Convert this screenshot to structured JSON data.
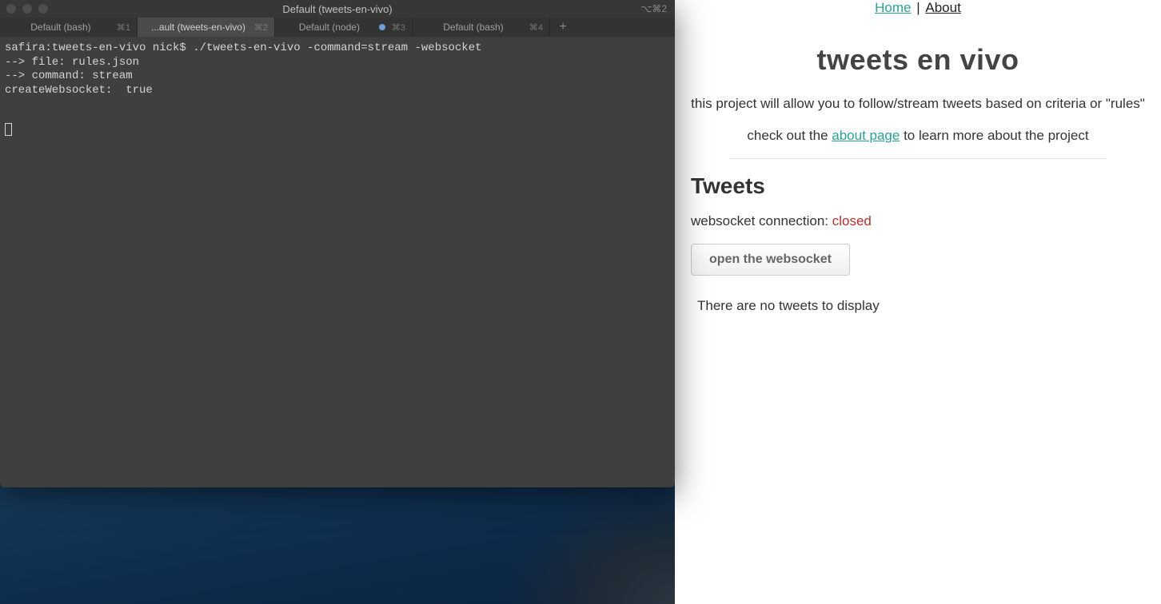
{
  "terminal": {
    "window_title": "Default (tweets-en-vivo)",
    "titlebar_shortcut": "⌥⌘2",
    "tabs": [
      {
        "label": "Default (bash)",
        "shortcut": "⌘1",
        "active": false,
        "indicator": false
      },
      {
        "label": "...ault (tweets-en-vivo)",
        "shortcut": "⌘2",
        "active": true,
        "indicator": false
      },
      {
        "label": "Default (node)",
        "shortcut": "⌘3",
        "active": false,
        "indicator": true
      },
      {
        "label": "Default (bash)",
        "shortcut": "⌘4",
        "active": false,
        "indicator": false
      }
    ],
    "add_tab_glyph": "+",
    "lines": [
      "safira:tweets-en-vivo nick$ ./tweets-en-vivo -command=stream -websocket",
      "--> file: rules.json",
      "--> command: stream",
      "createWebsocket:  true"
    ]
  },
  "web": {
    "nav": {
      "home": "Home",
      "sep": " | ",
      "about": "About"
    },
    "title": "tweets en vivo",
    "intro1": "this project will allow you to follow/stream tweets based on criteria or \"rules\"",
    "intro2_pre": "check out the ",
    "intro2_link": "about page",
    "intro2_post": " to learn more about the project",
    "section_title": "Tweets",
    "ws_label": "websocket connection: ",
    "ws_value": "closed",
    "ws_button": "open the websocket",
    "empty": "There are no tweets to display"
  }
}
